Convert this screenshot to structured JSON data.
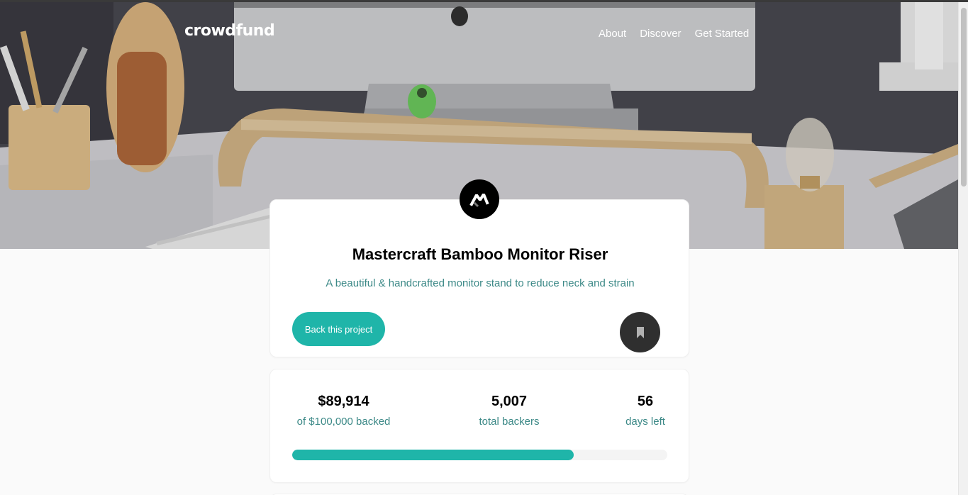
{
  "brand": {
    "logo_text": "crowdfund"
  },
  "nav": {
    "items": [
      "About",
      "Discover",
      "Get Started"
    ]
  },
  "project": {
    "title": "Mastercraft Bamboo Monitor Riser",
    "subtitle": "A beautiful & handcrafted monitor stand to reduce neck and strain",
    "back_label": "Back this project"
  },
  "stats": {
    "backed_amount": "$89,914",
    "backed_label": "of $100,000 backed",
    "backers_count": "5,007",
    "backers_label": "total backers",
    "days_left": "56",
    "days_label": "days left",
    "progress_fraction": 0.75
  },
  "colors": {
    "accent": "#1fb5a9",
    "accent_text": "#3c8987",
    "dark_button": "#2f2f2f",
    "hero_wall": "#4a4a52"
  },
  "icons": {
    "project_logo": "mastercraft-logo-icon",
    "bookmark": "bookmark-icon"
  }
}
